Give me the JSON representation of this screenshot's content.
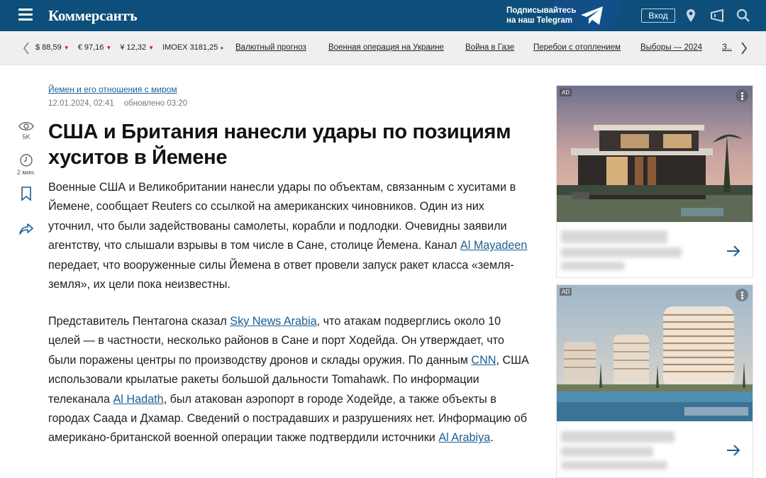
{
  "header": {
    "logo": "Коммерсантъ",
    "telegram_line1": "Подписывайтесь",
    "telegram_line2": "на наш Telegram",
    "login_label": "Вход"
  },
  "ticker": {
    "rates": [
      {
        "label": "$ 88,59",
        "trend": "down"
      },
      {
        "label": "€ 97,16",
        "trend": "down"
      },
      {
        "label": "¥ 12,32",
        "trend": "down"
      },
      {
        "label": "IMOEX 3181,25",
        "trend": "up"
      }
    ],
    "links": [
      "Валютный прогноз",
      "Военная операция на Украине",
      "Война в Газе",
      "Перебои с отоплением",
      "Выборы — 2024",
      "З..."
    ]
  },
  "rail": {
    "views": "5K",
    "read_time": "2 мин."
  },
  "article": {
    "rubric": "Йемен и его отношения с миром",
    "date": "12.01.2024, 02:41",
    "updated": "обновлено 03:20",
    "title": "США и Британия нанесли удары по позициям хуситов в Йемене",
    "p1_a": "Военные США и Великобритании нанесли удары по объектам, связанным с хуситами в Йемене, сообщает Reuters со ссылкой на американских чиновников. Один из них уточнил, что были задействованы самолеты, корабли и подлодки. Очевидны заявили агентству, что слышали взрывы в том числе в Сане, столице Йемена. Канал ",
    "p1_link": "Al Mayadeen",
    "p1_b": " передает, что вооруженные силы Йемена в ответ провели запуск ракет класса «земля-земля», их цели пока неизвестны.",
    "p2_a": "Представитель Пентагона сказал ",
    "p2_link1": "Sky News Arabia",
    "p2_b": ", что атакам подверглись около 10 целей — в частности, несколько районов в Сане и порт Ходейда. Он утверждает, что были поражены центры по производству дронов и склады оружия. По данным ",
    "p2_link2": "CNN",
    "p2_c": ", США использовали крылатые ракеты большой дальности Tomahawk. По информации телеканала ",
    "p2_link3": "Al Hadath",
    "p2_d": ", был атакован аэропорт в городе Ходейде, а также объекты в городах Саада и Дхамар. Сведений о пострадавших и разрушениях нет. Информацию об американо-британской военной операции также подтвердили источники ",
    "p2_link4": "Al Arabiya",
    "p2_e": "."
  },
  "ads": [
    {
      "badge": "AD"
    },
    {
      "badge": "AD"
    }
  ],
  "colors": {
    "header_bg": "#0d4f7a",
    "link": "#1a5f93",
    "rate_down": "#d4141b",
    "rate_up": "#1a9c3c"
  }
}
